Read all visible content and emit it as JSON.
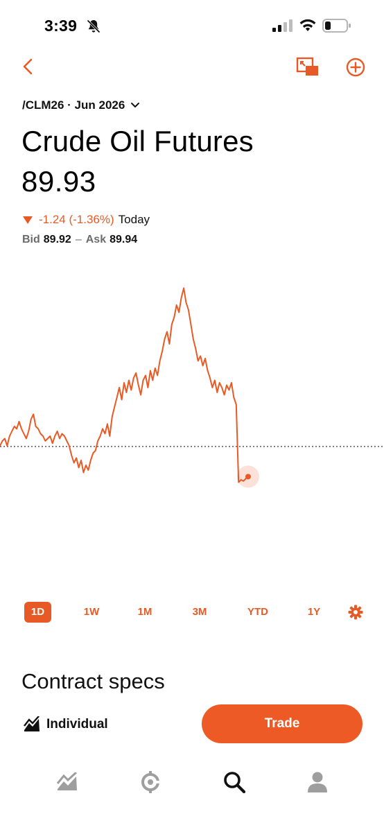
{
  "status_bar": {
    "time": "3:39",
    "icons": [
      "bell-muted-icon",
      "signal-icon",
      "wifi-icon",
      "battery-icon"
    ]
  },
  "header": {
    "icons": [
      "chevron-left-icon",
      "picture-in-picture-icon",
      "plus-circle-icon"
    ]
  },
  "contract": {
    "symbol_label": "/CLM26 · Jun 2026"
  },
  "instrument": {
    "title": "Crude Oil Futures",
    "price": "89.93",
    "change": "-1.24 (-1.36%)",
    "change_period": "Today",
    "bid_label": "Bid",
    "bid_value": "89.92",
    "ask_label": "Ask",
    "ask_value": "89.94"
  },
  "chart_data": {
    "type": "line",
    "title": "",
    "xlabel": "",
    "ylabel": "",
    "reference_line": "previous-close-dotted",
    "series": [
      {
        "values": [
          91.2,
          91.4,
          91.5,
          91.2,
          91.6,
          91.8,
          92.0,
          91.9,
          92.2,
          91.9,
          91.7,
          91.5,
          91.8,
          92.3,
          92.5,
          92.0,
          91.9,
          91.7,
          91.6,
          91.4,
          91.5,
          91.6,
          91.3,
          91.6,
          91.8,
          91.5,
          91.7,
          91.6,
          91.4,
          91.2,
          90.8,
          90.5,
          90.7,
          90.3,
          90.6,
          90.1,
          90.4,
          90.2,
          90.6,
          90.9,
          91.0,
          91.4,
          91.6,
          91.9,
          91.7,
          92.1,
          91.6,
          92.4,
          92.8,
          93.2,
          93.6,
          93.1,
          93.8,
          93.4,
          93.9,
          93.5,
          94.0,
          94.2,
          93.7,
          93.3,
          93.9,
          94.1,
          93.6,
          94.3,
          93.9,
          94.4,
          94.1,
          94.7,
          95.1,
          95.6,
          95.9,
          95.4,
          96.2,
          96.5,
          97.0,
          96.7,
          97.3,
          97.7,
          97.1,
          96.8,
          96.2,
          95.6,
          95.2,
          94.7,
          94.9,
          94.5,
          94.8,
          94.3,
          94.0,
          93.6,
          93.9,
          93.4,
          93.8,
          93.6,
          93.3,
          93.7,
          93.5,
          93.8,
          93.2,
          92.9,
          89.7,
          89.8,
          89.75,
          89.85,
          89.93
        ]
      }
    ],
    "last_value": 89.93
  },
  "ranges": {
    "tabs": [
      "1D",
      "1W",
      "1M",
      "3M",
      "YTD",
      "1Y"
    ],
    "active": "1D"
  },
  "sections": {
    "contract_specs_title": "Contract specs"
  },
  "action_bar": {
    "account_label": "Individual",
    "trade_label": "Trade"
  },
  "tab_bar": {
    "icons": [
      "investing-chart-icon",
      "crypto-icon",
      "search-icon",
      "account-icon"
    ],
    "active": "search-icon"
  },
  "colors": {
    "accent": "#e85a25",
    "accent_button": "#ee5a25",
    "tab_inactive": "#9e9e9e",
    "tab_active": "#111111",
    "reference_line": "#555555"
  }
}
